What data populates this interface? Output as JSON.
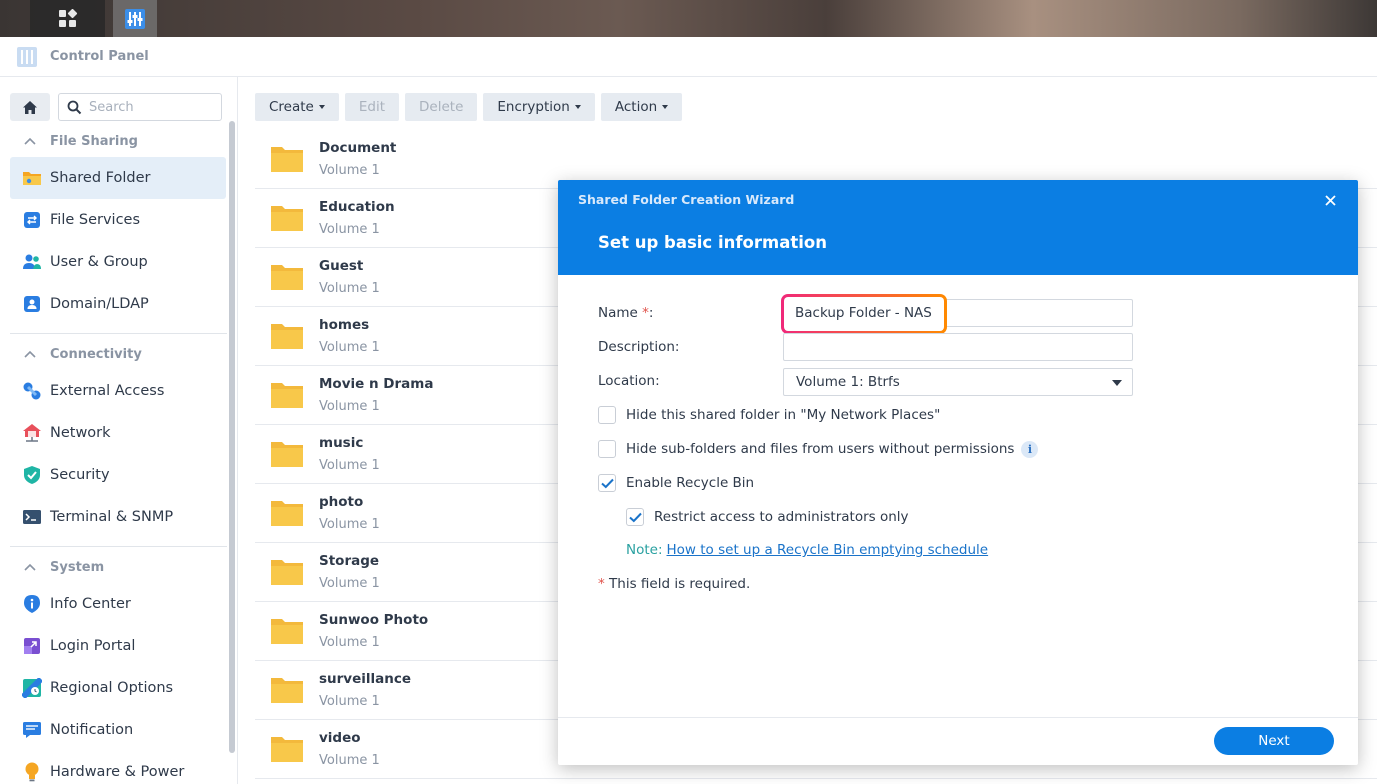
{
  "window": {
    "title": "Control Panel"
  },
  "search": {
    "placeholder": "Search"
  },
  "sidebar": {
    "sections": [
      {
        "label": "File Sharing"
      },
      {
        "label": "Connectivity"
      },
      {
        "label": "System"
      }
    ],
    "items": [
      {
        "label": "Shared Folder",
        "icon": "shared-folder-icon",
        "active": true
      },
      {
        "label": "File Services",
        "icon": "file-services-icon"
      },
      {
        "label": "User & Group",
        "icon": "user-group-icon"
      },
      {
        "label": "Domain/LDAP",
        "icon": "domain-ldap-icon"
      },
      {
        "label": "External Access",
        "icon": "external-access-icon"
      },
      {
        "label": "Network",
        "icon": "network-icon"
      },
      {
        "label": "Security",
        "icon": "security-icon"
      },
      {
        "label": "Terminal & SNMP",
        "icon": "terminal-icon"
      },
      {
        "label": "Info Center",
        "icon": "info-center-icon"
      },
      {
        "label": "Login Portal",
        "icon": "login-portal-icon"
      },
      {
        "label": "Regional Options",
        "icon": "regional-options-icon"
      },
      {
        "label": "Notification",
        "icon": "notification-icon"
      },
      {
        "label": "Hardware & Power",
        "icon": "hardware-power-icon"
      }
    ]
  },
  "toolbar": {
    "create": "Create",
    "edit": "Edit",
    "delete": "Delete",
    "encryption": "Encryption",
    "action": "Action"
  },
  "folders": [
    {
      "name": "Document",
      "volume": "Volume 1"
    },
    {
      "name": "Education",
      "volume": "Volume 1"
    },
    {
      "name": "Guest",
      "volume": "Volume 1"
    },
    {
      "name": "homes",
      "volume": "Volume 1"
    },
    {
      "name": "Movie n Drama",
      "volume": "Volume 1"
    },
    {
      "name": "music",
      "volume": "Volume 1"
    },
    {
      "name": "photo",
      "volume": "Volume 1"
    },
    {
      "name": "Storage",
      "volume": "Volume 1"
    },
    {
      "name": "Sunwoo Photo",
      "volume": "Volume 1"
    },
    {
      "name": "surveillance",
      "volume": "Volume 1"
    },
    {
      "name": "video",
      "volume": "Volume 1"
    }
  ],
  "dialog": {
    "wizard_title": "Shared Folder Creation Wizard",
    "step_title": "Set up basic information",
    "name_label": "Name",
    "name_required_mark": "*",
    "name_colon": ":",
    "name_value": "Backup Folder - NAS",
    "description_label": "Description:",
    "description_value": "",
    "location_label": "Location:",
    "location_value": "Volume 1:  Btrfs",
    "hide_network_places": {
      "label": "Hide this shared folder in \"My Network Places\"",
      "checked": false
    },
    "hide_subfolders": {
      "label": "Hide sub-folders and files from users without permissions",
      "checked": false
    },
    "info_glyph": "i",
    "enable_recycle_bin": {
      "label": "Enable Recycle Bin",
      "checked": true
    },
    "restrict_admin": {
      "label": "Restrict access to administrators only",
      "checked": true
    },
    "note_label": "Note:",
    "note_link": "How to set up a Recycle Bin emptying schedule",
    "required_mark": "*",
    "required_text": " This field is required.",
    "next_button": "Next"
  },
  "colors": {
    "accent": "#0b7ee3",
    "highlight_start": "#f0287a",
    "highlight_end": "#ff8a00",
    "folder": "#f8c84a"
  }
}
